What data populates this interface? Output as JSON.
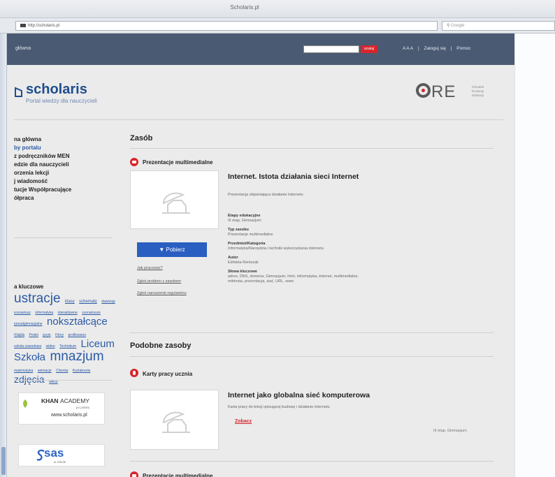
{
  "browser": {
    "window_title": "Scholaris.pl",
    "url": "http://scholaris.pl",
    "search_placeholder": "Google"
  },
  "header": {
    "nav_left": "główna",
    "search_button": "szukaj",
    "font_size": "A A A",
    "separator": "|",
    "login": "Zaloguj się",
    "help": "Pomoc"
  },
  "logo": {
    "name": "scholaris",
    "subtitle": "Portal wiedzy dla nauczycieli"
  },
  "ore": {
    "name": "ORE",
    "line1": "Ośrodek",
    "line2": "Rozwoju",
    "line3": "Edukacji"
  },
  "sidebar": {
    "items": [
      {
        "label": "na główna",
        "active": false
      },
      {
        "label": "by portalu",
        "active": true
      },
      {
        "label": "z podręczników MEN",
        "active": false
      },
      {
        "label": "edzie dla nauczycieli",
        "active": false
      },
      {
        "label": "orzenia lekcji",
        "active": false
      },
      {
        "label": "j wiadomość",
        "active": false
      },
      {
        "label": "tucje Współpracujące",
        "active": false
      },
      {
        "label": "ółpraca",
        "active": false
      }
    ],
    "tags_title": "a kluczowe",
    "tags": [
      {
        "text": "ustracje",
        "size": 19,
        "u": false
      },
      {
        "text": "klasy",
        "size": 6,
        "u": true
      },
      {
        "text": "schematy",
        "size": 6,
        "u": true
      },
      {
        "text": "dawnisja",
        "size": 5,
        "u": true
      },
      {
        "text": "scenariusz",
        "size": 5,
        "u": true
      },
      {
        "text": "informatyka",
        "size": 5,
        "u": true
      },
      {
        "text": "interaktywne",
        "size": 5,
        "u": true
      },
      {
        "text": "scenariusze",
        "size": 5,
        "u": true
      },
      {
        "text": "ponadgimnazjalne",
        "size": 5,
        "u": true
      },
      {
        "text": "nokształcące",
        "size": 15,
        "u": false
      },
      {
        "text": "mapa",
        "size": 6,
        "u": true
      },
      {
        "text": "Polski",
        "size": 5,
        "u": true
      },
      {
        "text": "język",
        "size": 5,
        "u": true
      },
      {
        "text": "Filmy",
        "size": 5,
        "u": true
      },
      {
        "text": "profilowane",
        "size": 5,
        "u": true
      },
      {
        "text": "szkoła zawodowa",
        "size": 5,
        "u": true
      },
      {
        "text": "wideo",
        "size": 5,
        "u": true
      },
      {
        "text": "Technikum",
        "size": 5,
        "u": true
      },
      {
        "text": "Liceum",
        "size": 15,
        "u": false
      },
      {
        "text": "Szkoła",
        "size": 15,
        "u": false
      },
      {
        "text": "mnazjum",
        "size": 19,
        "u": false
      },
      {
        "text": "matematyka",
        "size": 5,
        "u": true
      },
      {
        "text": "animacje",
        "size": 5,
        "u": true
      },
      {
        "text": "Chemia",
        "size": 5,
        "u": true
      },
      {
        "text": "Kształcenie",
        "size": 5,
        "u": true
      },
      {
        "text": "zdjęcia",
        "size": 14,
        "u": false
      },
      {
        "text": "tekst",
        "size": 6,
        "u": true
      }
    ]
  },
  "khan": {
    "title": "KHAN",
    "title2": "ACADEMY",
    "sub": "po polsku",
    "url": "www.scholaris.pl"
  },
  "sas": {
    "name": "sas",
    "sub": "w szkole"
  },
  "resource": {
    "section_title": "Zasób",
    "type": "Prezentacje multimedialne",
    "title": "Internet. Istota działania sieci Internet",
    "description": "Prezentacja objaśniająca działanie Internetu",
    "download": "▼ Pobierz",
    "links": [
      "Jak pracować?",
      "Zgłoś problem z zasobem",
      "Zgłoś naruszenie regulaminu"
    ],
    "meta": [
      {
        "label": "Etapy edukacyjne",
        "value": "III etap, Gimnazjum"
      },
      {
        "label": "Typ zasobu",
        "value": "Prezentacje multimedialne"
      },
      {
        "label": "Przedmiot/Kategoria",
        "value": "Informatyka/Narzędzia i techniki wykorzystania internetu"
      },
      {
        "label": "Autor",
        "value": "Elżbieta Reniszak"
      },
      {
        "label": "Słowa kluczowe",
        "value": "adres, DNS, domena, Gimnazjum, html, informatyka, internet, multimedialne,"
      },
      {
        "label": "",
        "value": "mitrinsta, prezentacja, siać, URL, www"
      }
    ]
  },
  "similar": {
    "section_title": "Podobne zasoby",
    "type": "Karty pracy ucznia",
    "title": "Internet jako globalna sieć komputerowa",
    "description": "Karta pracy do lekcji opisującej budowę i działanie Internetu",
    "link": "Zobacz",
    "stage": "III etap, Gimnazjum",
    "next_type": "Prezentacje multimedialne"
  }
}
